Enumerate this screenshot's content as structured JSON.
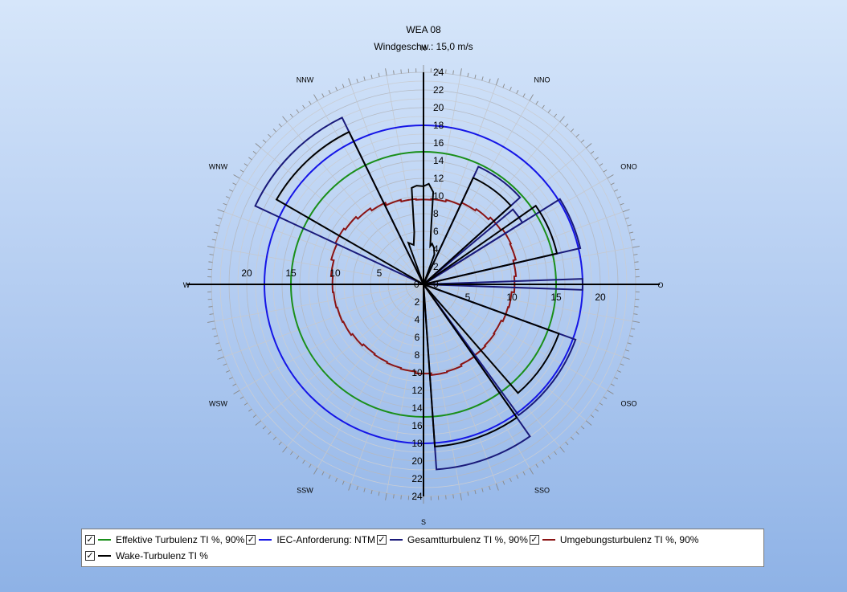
{
  "chart_data": {
    "type": "polar",
    "title": "WEA 08",
    "subtitle": "Windgeschw.: 15,0 m/s",
    "radial_max": 24,
    "radial_ticks": [
      "2",
      "4",
      "6",
      "8",
      "10",
      "12",
      "14",
      "16",
      "18",
      "20",
      "22",
      "24"
    ],
    "horizontal_labels": [
      "5",
      "10",
      "15",
      "20"
    ],
    "directions": [
      {
        "label": "N",
        "angle": 0
      },
      {
        "label": "NNO",
        "angle": 30
      },
      {
        "label": "ONO",
        "angle": 60
      },
      {
        "label": "O",
        "angle": 90
      },
      {
        "label": "OSO",
        "angle": 120
      },
      {
        "label": "SSO",
        "angle": 150
      },
      {
        "label": "S",
        "angle": 180
      },
      {
        "label": "SSW",
        "angle": 210
      },
      {
        "label": "WSW",
        "angle": 240
      },
      {
        "label": "W",
        "angle": 270
      },
      {
        "label": "WNW",
        "angle": 300
      },
      {
        "label": "NNW",
        "angle": 330
      }
    ],
    "circles": [
      {
        "name": "Effektive Turbulenz TI %, 90%",
        "value": 15,
        "color": "#1a8f1a"
      },
      {
        "name": "IEC-Anforderung: NTM",
        "value": 18,
        "color": "#1515e6"
      }
    ],
    "sectors": [
      {
        "name": "Gesamtturbulenz TI %, 90%",
        "color": "#1a1a7a",
        "wedges": [
          {
            "from": 25,
            "to": 48,
            "value": 14.7
          },
          {
            "from": 50,
            "to": 58,
            "value": 13.2
          },
          {
            "from": 58,
            "to": 77,
            "value": 18.2
          },
          {
            "from": 88,
            "to": 92,
            "value": 18.0
          },
          {
            "from": 110,
            "to": 144,
            "value": 18.3
          },
          {
            "from": 145,
            "to": 176,
            "value": 21.0
          },
          {
            "from": 295,
            "to": 334,
            "value": 21.0
          }
        ]
      },
      {
        "name": "Wake-Turbulenz TI %",
        "color": "#000000",
        "wedges": [
          {
            "from": 25,
            "to": 48,
            "value": 13.3
          },
          {
            "from": 55,
            "to": 77,
            "value": 15.5
          },
          {
            "from": 110,
            "to": 139,
            "value": 16.3
          },
          {
            "from": 145,
            "to": 176,
            "value": 18.4
          },
          {
            "from": 300,
            "to": 334,
            "value": 19.2
          }
        ]
      }
    ],
    "ambient": {
      "name": "Umgebungsturbulenz TI %, 90%",
      "color": "#8b1414",
      "values": [
        9.6,
        9.7,
        9.9,
        10.2,
        10.4,
        10.7,
        10.9,
        10.8,
        10.5,
        10.3,
        10.0,
        9.9,
        9.7,
        9.8,
        9.9,
        10.0,
        10.2,
        10.3,
        10.1,
        9.9,
        9.8,
        9.7,
        9.6,
        9.8,
        10.0,
        10.1,
        10.2,
        10.3,
        10.5,
        10.8,
        11.0,
        10.8,
        10.5,
        10.2,
        9.9,
        9.7
      ]
    },
    "wake_north": {
      "name": "Wake-Turbulenz TI %",
      "color": "#000000",
      "points": [
        [
          -20,
          5.0
        ],
        [
          -14,
          4.6
        ],
        [
          -10,
          6.0
        ],
        [
          -7,
          11.0
        ],
        [
          -4,
          11.2
        ],
        [
          0,
          11.1
        ],
        [
          3,
          11.4
        ],
        [
          6,
          10.5
        ],
        [
          8,
          6.0
        ],
        [
          10,
          4.4
        ],
        [
          12,
          4.7
        ],
        [
          16,
          4.3
        ],
        [
          20,
          3.6
        ]
      ]
    },
    "legend": [
      {
        "label": "Effektive Turbulenz TI %, 90%",
        "color": "#1a8f1a",
        "checked": "✓"
      },
      {
        "label": "IEC-Anforderung: NTM",
        "color": "#1515e6",
        "checked": "✓"
      },
      {
        "label": "Gesamtturbulenz TI %, 90%",
        "color": "#1a1a7a",
        "checked": "✓"
      },
      {
        "label": "Umgebungsturbulenz TI %, 90%",
        "color": "#8b1414",
        "checked": "✓"
      },
      {
        "label": "Wake-Turbulenz TI %",
        "color": "#000000",
        "checked": "✓"
      }
    ]
  }
}
